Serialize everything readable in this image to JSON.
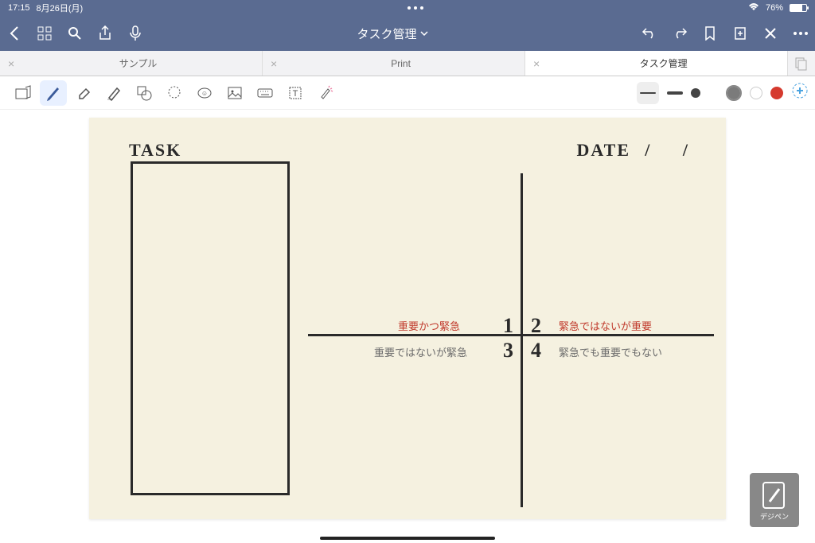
{
  "status": {
    "time": "17:15",
    "date": "8月26日(月)",
    "battery": "76%"
  },
  "app": {
    "title": "タスク管理",
    "tabs": [
      {
        "label": "サンプル",
        "active": false
      },
      {
        "label": "Print",
        "active": false
      },
      {
        "label": "タスク管理",
        "active": true
      }
    ]
  },
  "tools": {
    "items": [
      "zoom",
      "pen",
      "eraser",
      "highlighter",
      "shape",
      "lasso",
      "stamp",
      "image",
      "keyboard",
      "text",
      "laser"
    ],
    "strokes": [
      "thin",
      "med",
      "thick"
    ],
    "colors": {
      "gray": "#7b7b7b",
      "white": "#ffffff",
      "red": "#d53a2e"
    }
  },
  "page": {
    "task_label": "TASK",
    "date_label": "DATE",
    "date_slash": "/ /",
    "quadrants": {
      "q1": {
        "num": "1",
        "label": "重要かつ緊急"
      },
      "q2": {
        "num": "2",
        "label": "緊急ではないが重要"
      },
      "q3": {
        "num": "3",
        "label": "重要ではないが緊急"
      },
      "q4": {
        "num": "4",
        "label": "緊急でも重要でもない"
      }
    }
  },
  "watermark": "デジペン"
}
